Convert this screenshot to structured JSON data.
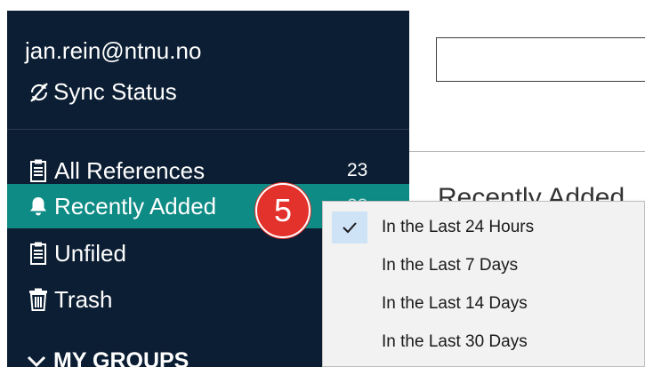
{
  "account": {
    "email": "jan.rein@ntnu.no"
  },
  "sync": {
    "label": "Sync Status",
    "icon": "sync-off-icon"
  },
  "nav": [
    {
      "label": "All References",
      "count": "23",
      "icon": "clipboard-icon"
    },
    {
      "label": "Recently Added",
      "count": "23",
      "icon": "bell-icon"
    },
    {
      "label": "Unfiled",
      "count": "",
      "icon": "clipboard-icon"
    },
    {
      "label": "Trash",
      "count": "",
      "icon": "trash-icon"
    }
  ],
  "groups": {
    "label": "MY GROUPS",
    "icon": "chevron-down-icon"
  },
  "main": {
    "title": "Recently Added"
  },
  "badge": {
    "number": "5",
    "color": "#e3312c"
  },
  "menu": {
    "items": [
      {
        "label": "In the Last 24 Hours",
        "selected": true
      },
      {
        "label": "In the Last 7 Days",
        "selected": false
      },
      {
        "label": "In the Last 14 Days",
        "selected": false
      },
      {
        "label": "In the Last 30 Days",
        "selected": false
      }
    ]
  },
  "colors": {
    "sidebar": "#0c1e33",
    "active": "#0f8b85",
    "menu_bg": "#f2f2f2"
  }
}
